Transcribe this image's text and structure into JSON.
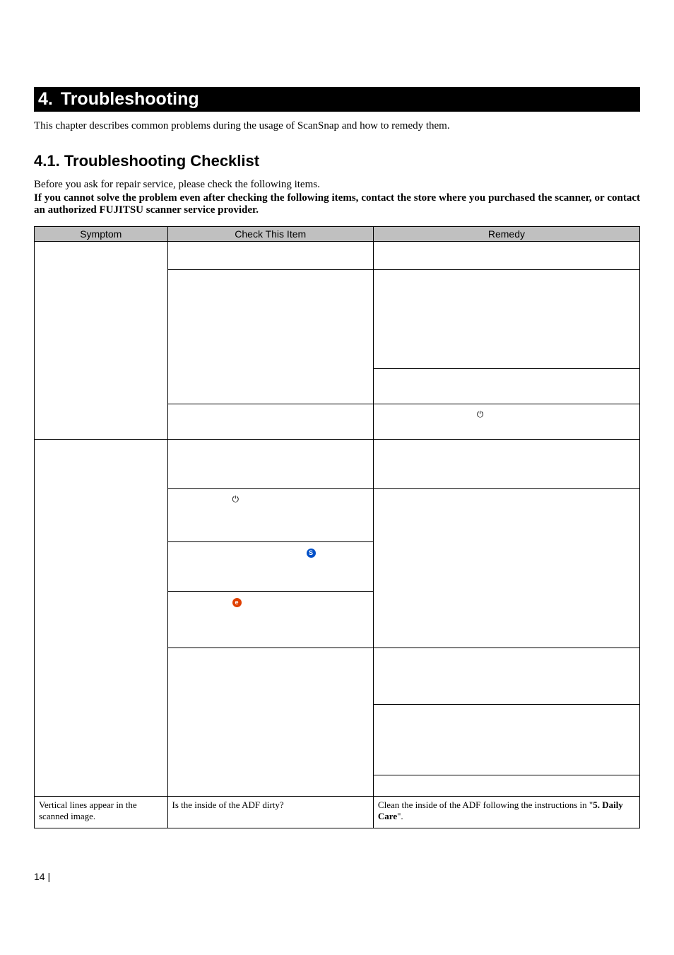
{
  "chapter": {
    "num": "4.",
    "title": "Troubleshooting"
  },
  "intro": "This chapter describes common problems during the usage of ScanSnap and how to remedy them.",
  "section": {
    "num": "4.1.",
    "title": "Troubleshooting Checklist"
  },
  "pre_note": "Before you ask for repair service, please check the following items.",
  "bold_note": "If you cannot solve the problem even after checking the following items, contact the store where you purchased the scanner, or contact an authorized FUJITSU scanner service provider.",
  "headers": {
    "symptom": "Symptom",
    "check": "Check This Item",
    "remedy": "Remedy"
  },
  "last_row": {
    "symptom": "Vertical lines appear in the scanned image.",
    "check": "Is the inside of the ADF dirty?",
    "remedy_a": "Clean the inside of the ADF following the instructions in \"",
    "remedy_b": "5. Daily Care",
    "remedy_c": "\"."
  },
  "page": "14 |"
}
